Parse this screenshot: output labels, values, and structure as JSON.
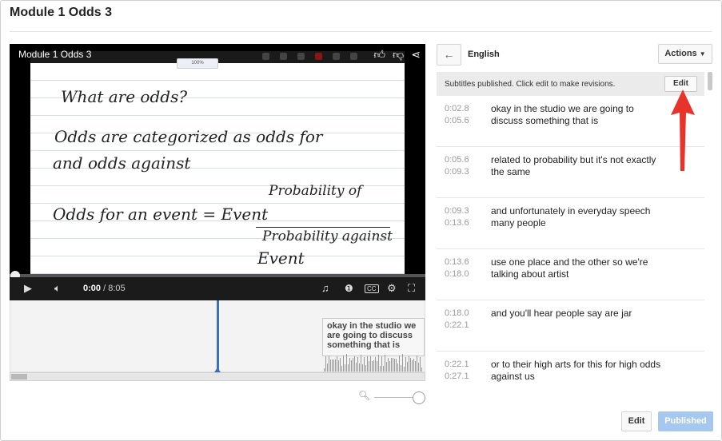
{
  "page": {
    "title": "Module 1 Odds 3"
  },
  "video": {
    "title": "Module 1 Odds 3",
    "zoom_label": "100%",
    "whiteboard_lines": [
      "What are odds?",
      "Odds are categorized as odds for",
      "and odds against",
      "Probability of",
      "Odds for an event = Event",
      "Probability against",
      "Event"
    ],
    "current_time": "0:00",
    "separator": " / ",
    "duration": "8:05",
    "progress_fraction": 0.0,
    "icons": {
      "like": "thumbs-up-icon",
      "dislike": "thumbs-down-icon",
      "share": "share-icon",
      "play": "play-icon",
      "volume": "volume-icon",
      "music": "music-note-icon",
      "info": "info-icon",
      "captions": "cc-icon",
      "settings": "gear-icon",
      "fullscreen": "fullscreen-icon"
    }
  },
  "timeline": {
    "caption_bubble": "okay in the studio we are going to discuss something that is"
  },
  "panel": {
    "language": "English",
    "actions_label": "Actions",
    "notice": "Subtitles published. Click edit to make revisions.",
    "notice_edit_label": "Edit",
    "subtitles": [
      {
        "start": "0:02.8",
        "end": "0:05.6",
        "text": "okay in the studio we are going to discuss something that is"
      },
      {
        "start": "0:05.6",
        "end": "0:09.3",
        "text": "related to probability but it's not exactly the same"
      },
      {
        "start": "0:09.3",
        "end": "0:13.6",
        "text": "and unfortunately in everyday speech many people"
      },
      {
        "start": "0:13.6",
        "end": "0:18.0",
        "text": "use one place and the other so we're talking about artist"
      },
      {
        "start": "0:18.0",
        "end": "0:22.1",
        "text": "and you'll hear people say are jar"
      },
      {
        "start": "0:22.1",
        "end": "0:27.1",
        "text": "or to their high arts for this for high odds against us"
      }
    ]
  },
  "footer": {
    "edit_label": "Edit",
    "published_label": "Published"
  },
  "colors": {
    "accent": "#3b6fb6",
    "published_button": "#a6c8ef",
    "arrow": "#e8332a"
  }
}
